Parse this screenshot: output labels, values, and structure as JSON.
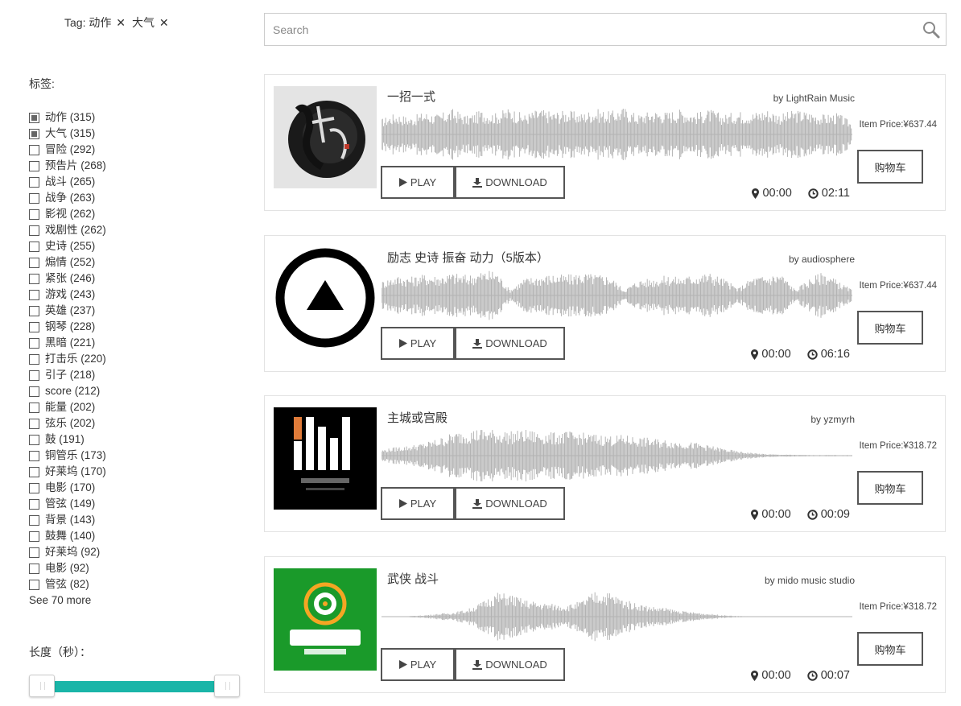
{
  "active_tags": {
    "prefix": "Tag: ",
    "tags": [
      "动作",
      "大气"
    ],
    "remove_glyph": "✕"
  },
  "sidebar": {
    "facet_title": "标签:",
    "facets": [
      {
        "label": "动作 (315)",
        "checked": true
      },
      {
        "label": "大气 (315)",
        "checked": true
      },
      {
        "label": "冒险 (292)",
        "checked": false
      },
      {
        "label": "预告片 (268)",
        "checked": false
      },
      {
        "label": "战斗 (265)",
        "checked": false
      },
      {
        "label": "战争 (263)",
        "checked": false
      },
      {
        "label": "影视 (262)",
        "checked": false
      },
      {
        "label": "戏剧性 (262)",
        "checked": false
      },
      {
        "label": "史诗 (255)",
        "checked": false
      },
      {
        "label": "煽情 (252)",
        "checked": false
      },
      {
        "label": "紧张 (246)",
        "checked": false
      },
      {
        "label": "游戏 (243)",
        "checked": false
      },
      {
        "label": "英雄 (237)",
        "checked": false
      },
      {
        "label": "钢琴 (228)",
        "checked": false
      },
      {
        "label": "黑暗 (221)",
        "checked": false
      },
      {
        "label": "打击乐 (220)",
        "checked": false
      },
      {
        "label": "引子 (218)",
        "checked": false
      },
      {
        "label": "score (212)",
        "checked": false
      },
      {
        "label": "能量 (202)",
        "checked": false
      },
      {
        "label": "弦乐 (202)",
        "checked": false
      },
      {
        "label": "鼓 (191)",
        "checked": false
      },
      {
        "label": "铜管乐 (173)",
        "checked": false
      },
      {
        "label": "好莱坞 (170)",
        "checked": false
      },
      {
        "label": "电影 (170)",
        "checked": false
      },
      {
        "label": "管弦 (149)",
        "checked": false
      },
      {
        "label": "背景 (143)",
        "checked": false
      },
      {
        "label": "鼓舞 (140)",
        "checked": false
      },
      {
        "label": "好莱坞 (92)",
        "checked": false
      },
      {
        "label": "电影 (92)",
        "checked": false
      },
      {
        "label": "管弦 (82)",
        "checked": false
      }
    ],
    "see_more": "See 70 more",
    "length_title": "长度（秒）：",
    "slider": {
      "low": 0,
      "high": 1
    }
  },
  "search": {
    "placeholder": "Search",
    "value": "",
    "icon": "search-icon"
  },
  "labels": {
    "play": "PLAY",
    "download": "DOWNLOAD",
    "cart": "购物车"
  },
  "colors": {
    "accent": "#1ab5a8",
    "wave": "#b3b3b3",
    "border": "#555555"
  },
  "tracks": [
    {
      "title": "一招一式",
      "author": "by LightRain Music",
      "price": "Item Price:¥637.44",
      "position": "00:00",
      "duration": "02:11",
      "cover": "ink-brush",
      "envelope": [
        0.55,
        0.75,
        0.6,
        0.8,
        0.7,
        0.9,
        0.65,
        0.85,
        0.75,
        0.95,
        0.7,
        0.9,
        0.8,
        0.85,
        0.75,
        0.9,
        0.8,
        0.95,
        0.7,
        0.85,
        0.8,
        0.9,
        0.75,
        0.88,
        0.7,
        0.82,
        0.78,
        0.9,
        0.72,
        0.86,
        0.8,
        0.7,
        0.75,
        0.4
      ]
    },
    {
      "title": "励志 史诗 振奋 动力（5版本）",
      "author": "by audiosphere",
      "price": "Item Price:¥637.44",
      "position": "00:00",
      "duration": "06:16",
      "cover": "triangle-logo",
      "envelope": [
        0.5,
        0.7,
        0.65,
        0.75,
        0.7,
        0.8,
        0.72,
        0.85,
        0.9,
        0.2,
        0.6,
        0.7,
        0.75,
        0.72,
        0.8,
        0.75,
        0.7,
        0.2,
        0.55,
        0.6,
        0.7,
        0.65,
        0.75,
        0.8,
        0.6,
        0.25,
        0.65,
        0.7,
        0.8,
        0.2,
        0.6,
        0.85,
        0.5,
        0.2
      ]
    },
    {
      "title": "主城或宫殿",
      "author": "by yzmyrh",
      "price": "Item Price:¥318.72",
      "position": "00:00",
      "duration": "00:09",
      "cover": "moongate-logo",
      "envelope": [
        0.2,
        0.3,
        0.35,
        0.45,
        0.6,
        0.8,
        0.9,
        0.95,
        0.9,
        0.85,
        0.9,
        0.85,
        0.8,
        0.85,
        0.8,
        0.75,
        0.7,
        0.72,
        0.65,
        0.6,
        0.55,
        0.5,
        0.45,
        0.35,
        0.25,
        0.15,
        0.1,
        0.05,
        0.04,
        0.03,
        0.02,
        0.02,
        0.02,
        0.02
      ]
    },
    {
      "title": "武侠 战斗",
      "author": "by mido music studio",
      "price": "Item Price:¥318.72",
      "position": "00:00",
      "duration": "00:07",
      "cover": "mido-logo",
      "envelope": [
        0.01,
        0.01,
        0.02,
        0.05,
        0.1,
        0.15,
        0.25,
        0.5,
        0.85,
        0.8,
        0.6,
        0.5,
        0.45,
        0.4,
        0.55,
        0.9,
        0.85,
        0.6,
        0.45,
        0.35,
        0.3,
        0.2,
        0.15,
        0.1,
        0.05,
        0.02,
        0.01,
        0.01,
        0.01,
        0.01,
        0.01,
        0.01,
        0.01,
        0.01
      ]
    }
  ]
}
